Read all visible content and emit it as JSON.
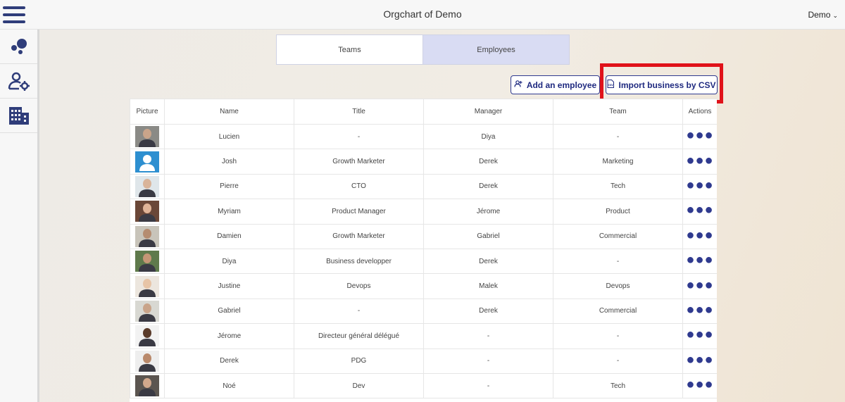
{
  "header": {
    "title": "Orgchart of Demo",
    "user_menu": "Demo"
  },
  "tabs": [
    {
      "label": "Teams",
      "active": false
    },
    {
      "label": "Employees",
      "active": true
    }
  ],
  "actions": {
    "add_employee": "Add an employee",
    "import_csv": "Import business by CSV"
  },
  "table": {
    "headers": [
      "Picture",
      "Name",
      "Title",
      "Manager",
      "Team",
      "Actions"
    ],
    "rows": [
      {
        "name": "Lucien",
        "title": "-",
        "manager": "Diya",
        "team": "-",
        "avatar": "photo",
        "avatar_bg": "#8a8a86",
        "skin": "#c9a48a"
      },
      {
        "name": "Josh",
        "title": "Growth Marketer",
        "manager": "Derek",
        "team": "Marketing",
        "avatar": "placeholder",
        "avatar_bg": "#2d8fd0",
        "skin": "#ffffff"
      },
      {
        "name": "Pierre",
        "title": "CTO",
        "manager": "Derek",
        "team": "Tech",
        "avatar": "photo",
        "avatar_bg": "#dfe6ea",
        "skin": "#d9b49a"
      },
      {
        "name": "Myriam",
        "title": "Product Manager",
        "manager": "Jérome",
        "team": "Product",
        "avatar": "photo",
        "avatar_bg": "#6a4738",
        "skin": "#e0b498"
      },
      {
        "name": "Damien",
        "title": "Growth Marketer",
        "manager": "Gabriel",
        "team": "Commercial",
        "avatar": "photo",
        "avatar_bg": "#c8c4ba",
        "skin": "#b58c70"
      },
      {
        "name": "Diya",
        "title": "Business developper",
        "manager": "Derek",
        "team": "-",
        "avatar": "photo",
        "avatar_bg": "#5f7a4c",
        "skin": "#c59676"
      },
      {
        "name": "Justine",
        "title": "Devops",
        "manager": "Malek",
        "team": "Devops",
        "avatar": "photo",
        "avatar_bg": "#ece6de",
        "skin": "#e7c4a6"
      },
      {
        "name": "Gabriel",
        "title": "-",
        "manager": "Derek",
        "team": "Commercial",
        "avatar": "photo",
        "avatar_bg": "#d8d8d2",
        "skin": "#c9a48a"
      },
      {
        "name": "Jérome",
        "title": "Directeur général délégué",
        "manager": "-",
        "team": "-",
        "avatar": "photo",
        "avatar_bg": "#f2f2f2",
        "skin": "#5a3b2a"
      },
      {
        "name": "Derek",
        "title": "PDG",
        "manager": "-",
        "team": "-",
        "avatar": "photo",
        "avatar_bg": "#eeeeee",
        "skin": "#b9896b"
      },
      {
        "name": "Noé",
        "title": "Dev",
        "manager": "-",
        "team": "Tech",
        "avatar": "photo",
        "avatar_bg": "#5b5550",
        "skin": "#d2a88c"
      }
    ],
    "actions_glyph": "●●●"
  },
  "colors": {
    "primary": "#2f3a8f",
    "highlight": "#e0121a",
    "active_tab": "#d9dcf3"
  }
}
